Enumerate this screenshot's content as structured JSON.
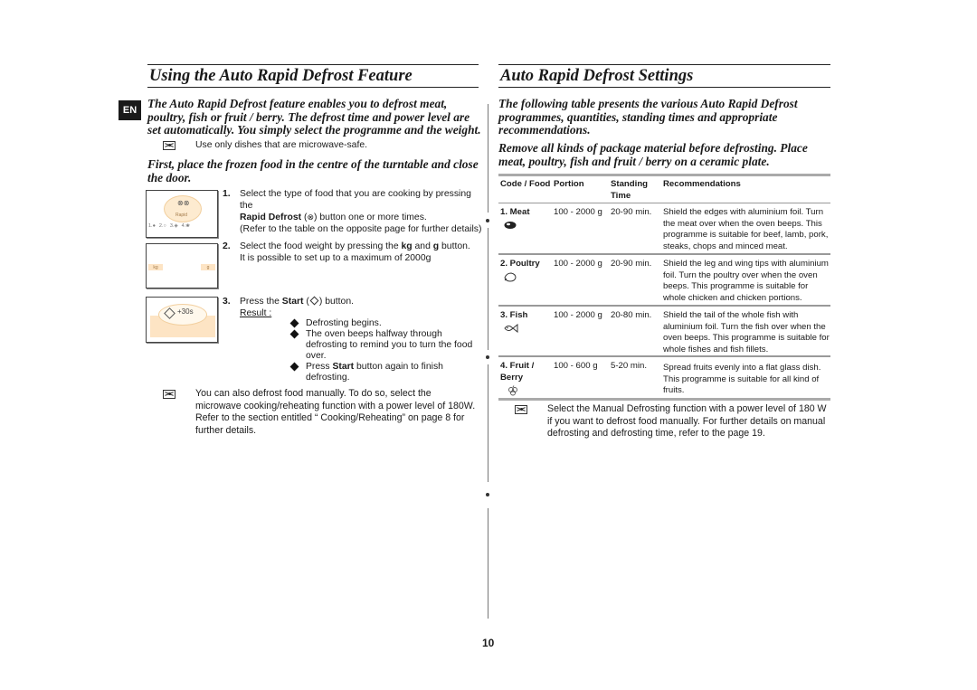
{
  "left_section": {
    "title": "Using the Auto Rapid Defrost Feature",
    "lang_tab": "EN",
    "intro": "The Auto Rapid Defrost feature enables you to defrost meat, poultry, fish or fruit / berry.  The defrost time and power level are set automatically.  You simply select the programme and the weight.",
    "note_dishes": "Use only dishes that are microwave-safe.",
    "first_instruction": "First, place the frozen food in the centre of the turntable and close the door.",
    "steps": [
      {
        "number": "1.",
        "text_a": "Select the type of food that you are cooking by pressing the",
        "bold": "Rapid Defrost",
        "text_b": "button one or more times.",
        "text_c": "(Refer to the table on the opposite page for further details)"
      },
      {
        "number": "2.",
        "text_a": "Select the food weight by pressing the",
        "bold_kg": "kg",
        "text_and": "and",
        "bold_g": "g",
        "text_b": "button.",
        "text_c": "It is possible to set up to a maximum of 2000g"
      },
      {
        "number": "3.",
        "text_a": "Press the",
        "bold": "Start",
        "text_b": "button.",
        "result_label": "Result :"
      }
    ],
    "result_bullets": [
      {
        "text": "Defrosting begins."
      },
      {
        "text": "The oven beeps halfway through defrosting to remind you to turn the food over."
      },
      {
        "pre": "Press",
        "bold": "Start",
        "post": "button again to finish defrosting."
      }
    ],
    "note_manual": "You can also defrost food manually. To do so, select the microwave cooking/reheating function with a power level of 180W. Refer to the section entitled “ Cooking/Reheating” on page 8 for further details.",
    "panels": {
      "rapid_label": "Rapid",
      "rapid_options": [
        "1.",
        "2.",
        "3.",
        "4."
      ],
      "kg_label": "kg",
      "g_label": "g",
      "start_label": "+30s"
    }
  },
  "right_section": {
    "title": "Auto Rapid Defrost Settings",
    "intro": "The following table presents the various Auto Rapid Defrost programmes, quantities, standing times and appropriate recommendations.",
    "instruction": "Remove all kinds of package material before defrosting. Place meat, poultry, fish and fruit / berry on a ceramic plate.",
    "table": {
      "headers": [
        "Code / Food",
        "Portion",
        "Standing Time",
        "Recommendations"
      ],
      "rows": [
        {
          "food": "1. Meat",
          "icon": "meat-icon",
          "portion": "100 - 2000 g",
          "standing_time": "20-90 min.",
          "recommendation": "Shield the edges with aluminium foil. Turn the meat over when the oven beeps. This programme is suitable for beef, lamb, pork, steaks, chops and minced meat."
        },
        {
          "food": "2. Poultry",
          "icon": "poultry-icon",
          "portion": "100 - 2000 g",
          "standing_time": "20-90 min.",
          "recommendation": "Shield the leg and wing tips with aluminium foil. Turn the poultry over when the oven beeps. This programme is suitable for whole chicken and chicken portions."
        },
        {
          "food": "3. Fish",
          "icon": "fish-icon",
          "portion": "100 - 2000 g",
          "standing_time": "20-80 min.",
          "recommendation": "Shield the tail of the whole fish with aluminium foil. Turn the fish over when the oven beeps. This programme is suitable for whole fishes and fish fillets."
        },
        {
          "food": "4. Fruit / Berry",
          "icon": "fruit-berry-icon",
          "portion": "100 - 600 g",
          "standing_time": "5-20 min.",
          "recommendation": "Spread fruits evenly into a flat glass dish. This programme is suitable for all kind of fruits."
        }
      ]
    },
    "note_manual": "Select the Manual Defrosting function with a power level of 180 W if you want to defrost food manually. For further details on manual defrosting and defrosting time, refer to the page 19."
  },
  "page_number": "10"
}
